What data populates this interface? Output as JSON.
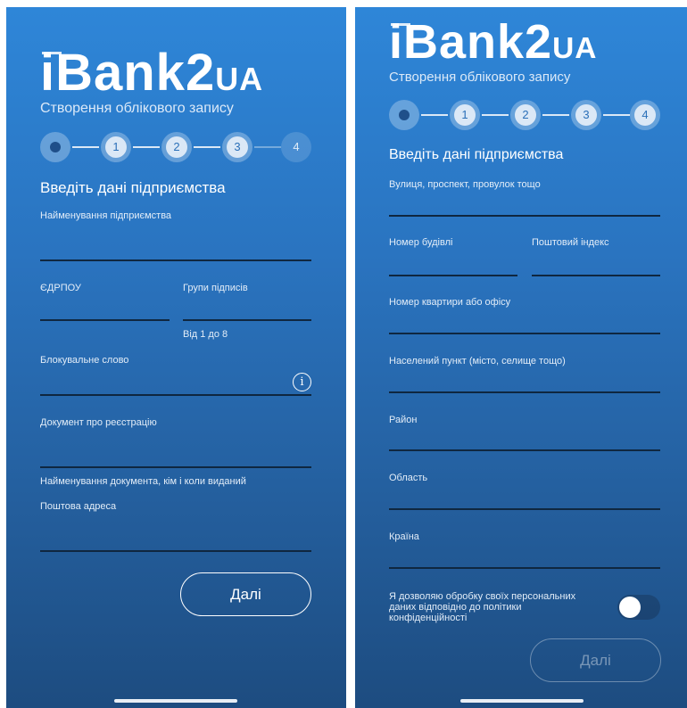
{
  "brand": {
    "main": "iBank2",
    "suffix": "UA"
  },
  "subtitle": "Створення облікового запису",
  "steps": [
    "1",
    "2",
    "3",
    "4"
  ],
  "heading": "Введіть дані підприємства",
  "screen1": {
    "company_name_label": "Найменування підприємства",
    "edrpou_label": "ЄДРПОУ",
    "signature_groups_label": "Групи підписів",
    "signature_groups_hint": "Від 1 до 8",
    "blocking_word_label": "Блокувальне слово",
    "info_icon_glyph": "i",
    "registration_doc_label": "Документ про реєстрацію",
    "registration_doc_hint": "Найменування документа, кім і коли виданий",
    "postal_address_label": "Поштова адреса",
    "next_button": "Далі"
  },
  "screen2": {
    "street_label": "Вулиця, проспект, провулок тощо",
    "building_label": "Номер будівлі",
    "postcode_label": "Поштовий індекс",
    "apartment_label": "Номер квартири або офісу",
    "settlement_label": "Населений пункт (місто, селище тощо)",
    "district_label": "Район",
    "region_label": "Область",
    "country_label": "Країна",
    "consent_text": "Я дозволяю обробку своїх персональних даних відповідно до політики конфіденційності",
    "consent_enabled": false,
    "next_button": "Далі"
  }
}
